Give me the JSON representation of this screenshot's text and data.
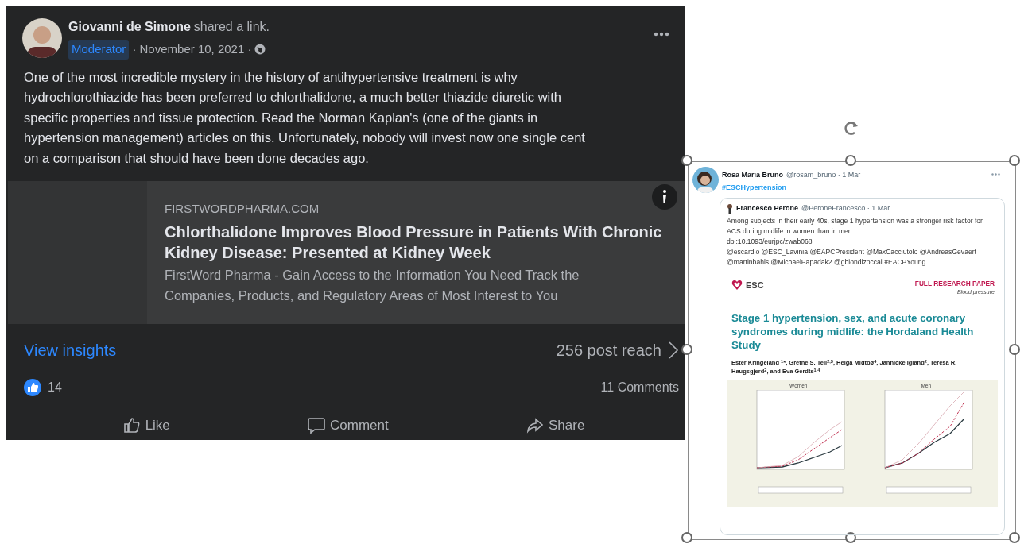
{
  "post": {
    "author": "Giovanni de Simone",
    "action": "shared a link.",
    "badge": "Moderator",
    "date": "· November 10, 2021 ·",
    "body": "One of the most incredible mystery in the history of antihypertensive treatment is why hydrochlorothiazide has been preferred to chlorthalidone, a much better thiazide diuretic with specific properties and tissue protection. Read the Norman Kaplan's (one of the giants in hypertension management) articles on this. Unfortunately, nobody will invest now one single cent on a comparison that should have been done decades ago.",
    "link": {
      "domain": "FIRSTWORDPHARMA.COM",
      "title": "Chlorthalidone Improves Blood Pressure in Patients With Chronic Kidney Disease: Presented at Kidney Week",
      "description": "FirstWord Pharma - Gain Access to the Information You Need Track the Companies, Products, and Regulatory Areas of Most Interest to You"
    },
    "insights": "View insights",
    "reach": "256 post reach",
    "reactions": "14",
    "comments": "11 Comments",
    "actions": [
      {
        "kind": "like",
        "label": "Like"
      },
      {
        "kind": "comment",
        "label": "Comment"
      },
      {
        "kind": "share",
        "label": "Share"
      }
    ]
  },
  "pasted_image": {
    "tweet": {
      "author": "Rosa Maria Bruno",
      "handle": "@rosam_bruno · 1 Mar",
      "hashtag": "#ESCHypertension",
      "quoted": {
        "author": "Francesco Perone",
        "handle": "@PeroneFrancesco · 1 Mar",
        "text": "Among subjects in their early 40s, stage 1 hypertension was a stronger risk factor for ACS during midlife in women than in men.",
        "doi": "doi:10.1093/eurjpc/zwab068",
        "mentions": "@escardio @ESC_Lavinia @EAPCPresident @MaxCacciutolo @AndreasGevaert @martinbahls @MichaelPapadak2 @gbiondizoccai #EACPYoung"
      },
      "paper": {
        "logo": "ESC",
        "type": "FULL RESEARCH PAPER",
        "section": "Blood pressure",
        "title": "Stage 1 hypertension, sex, and acute coronary syndromes during midlife: the Hordaland Health Study",
        "authors": "Ester Kringeland $^{1}$*, Grethe S. Tell$^{2,3}$, Helga Midtbø$^{4}$, Jannicke Igland$^{2}$, Teresa R. Haugsgjerd$^{2}$, and Eva Gerdts$^{1,4}$",
        "figures": [
          {
            "title": "Women"
          },
          {
            "title": "Men"
          }
        ]
      }
    }
  }
}
